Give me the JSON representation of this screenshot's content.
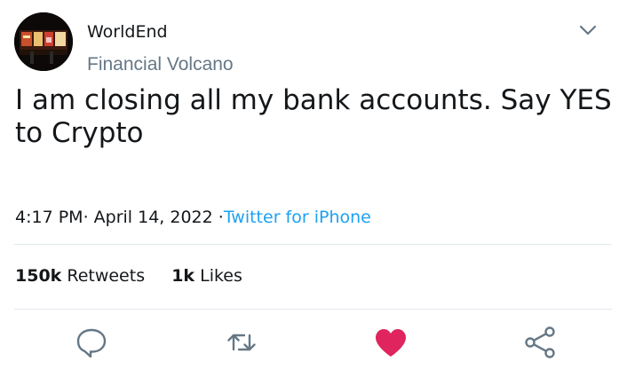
{
  "author": {
    "display_name": "WorldEnd",
    "handle": "Financial Volcano",
    "avatar_icon": "avatar-image"
  },
  "menu_icon": "chevron-down-icon",
  "tweet": {
    "text": "I am closing all my bank accounts. Say YES to Crypto",
    "time": "4:17 PM",
    "separator1": "·",
    "date": "April 14, 2022",
    "separator2": "·",
    "source": "Twitter for iPhone"
  },
  "stats": {
    "retweets_count": "150k",
    "retweets_label": "Retweets",
    "likes_count": "1k",
    "likes_label": "Likes"
  },
  "actions": {
    "reply_icon": "reply-icon",
    "retweet_icon": "retweet-icon",
    "like_icon": "heart-icon",
    "share_icon": "share-icon",
    "like_color": "#e0245e",
    "icon_color": "#657786"
  },
  "colors": {
    "link": "#1da1f2",
    "divider": "#e1e8ed",
    "secondary_text": "#657786"
  }
}
